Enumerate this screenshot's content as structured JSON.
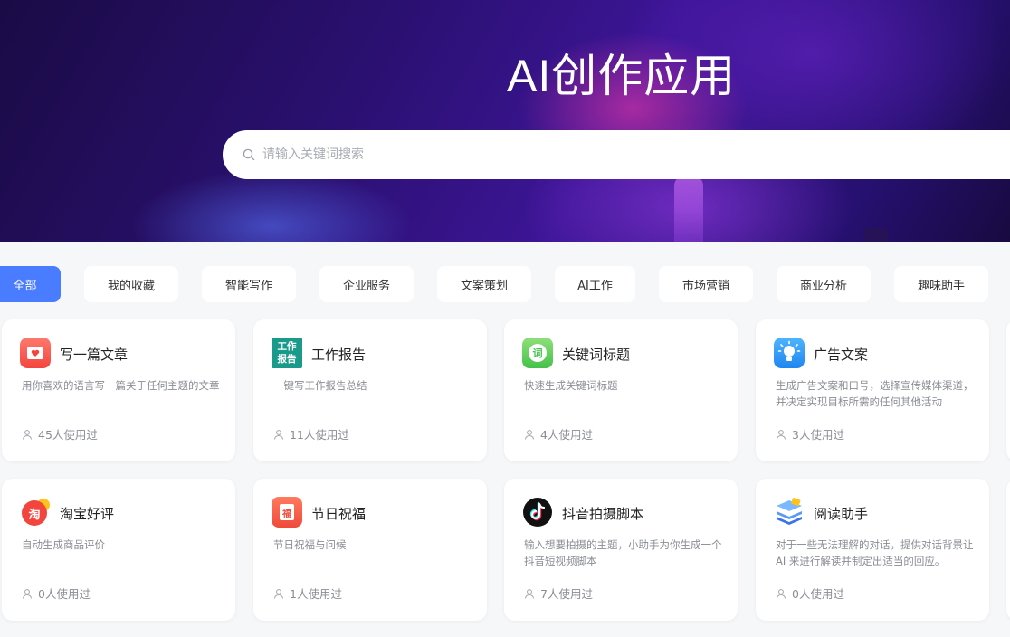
{
  "hero": {
    "title": "AI创作应用"
  },
  "search": {
    "placeholder": "请输入关键词搜索"
  },
  "categories": [
    "全部",
    "我的收藏",
    "智能写作",
    "企业服务",
    "文案策划",
    "AI工作",
    "市场营销",
    "商业分析",
    "趣味助手"
  ],
  "active_category": "全部",
  "cards": [
    {
      "title": "写一篇文章",
      "desc": "用你喜欢的语言写一篇关于任何主题的文章",
      "usage": "45人使用过",
      "icon": "article-icon"
    },
    {
      "title": "工作报告",
      "desc": "一键写工作报告总结",
      "usage": "11人使用过",
      "icon": "work-report-icon",
      "icon_text": [
        "工作",
        "报告"
      ]
    },
    {
      "title": "关键词标题",
      "desc": "快速生成关键词标题",
      "usage": "4人使用过",
      "icon": "keyword-icon",
      "icon_text": [
        "词"
      ]
    },
    {
      "title": "广告文案",
      "desc": "生成广告文案和口号，选择宣传媒体渠道，并决定实现目标所需的任何其他活动",
      "usage": "3人使用过",
      "icon": "ad-copy-icon"
    },
    {
      "title": "淘宝好评",
      "desc": "自动生成商品评价",
      "usage": "0人使用过",
      "icon": "taobao-icon",
      "icon_text": [
        "淘"
      ]
    },
    {
      "title": "节日祝福",
      "desc": "节日祝福与问候",
      "usage": "1人使用过",
      "icon": "festival-icon",
      "icon_text": [
        "福"
      ]
    },
    {
      "title": "抖音拍摄脚本",
      "desc": "输入想要拍摄的主题，小助手为你生成一个抖音短视频脚本",
      "usage": "7人使用过",
      "icon": "douyin-icon"
    },
    {
      "title": "阅读助手",
      "desc": "对于一些无法理解的对话，提供对话背景让 AI 来进行解读并制定出适当的回应。",
      "usage": "0人使用过",
      "icon": "reading-icon"
    }
  ],
  "colors": {
    "accent": "#4a7cff"
  }
}
